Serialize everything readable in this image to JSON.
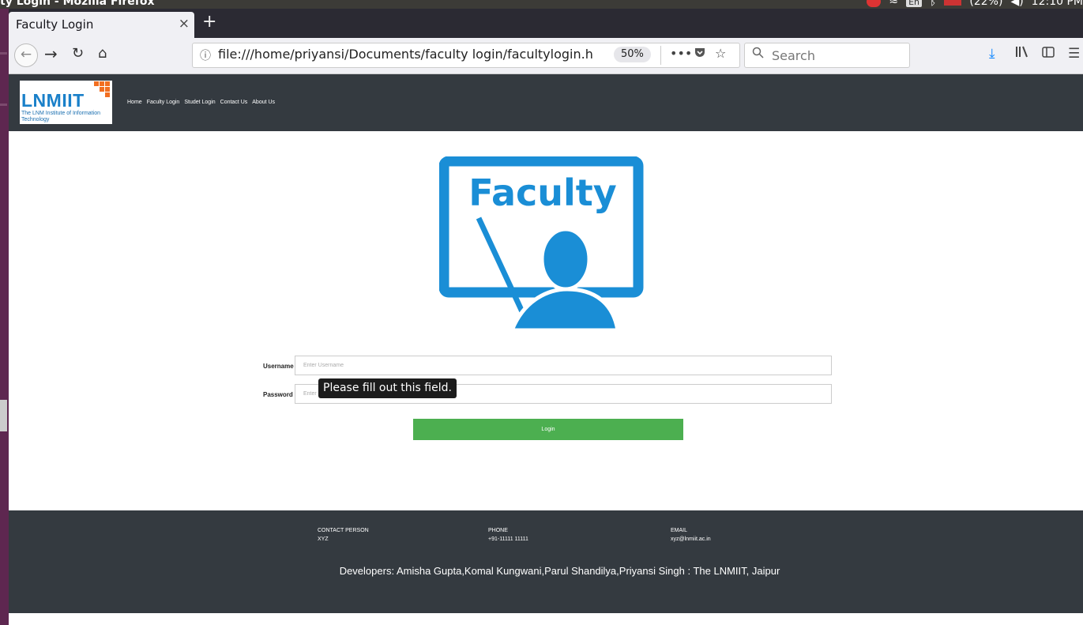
{
  "os": {
    "window_title": "ty Login - Mozilla Firefox",
    "tray": {
      "keyboard": "En",
      "battery": "(22%)",
      "clock": "12:10 PM"
    }
  },
  "browser": {
    "tab_title": "Faculty Login",
    "tab_close": "×",
    "new_tab": "+",
    "url": "file:///home/priyansi/Documents/faculty login/facultylogin.html",
    "zoom": "50%",
    "search_placeholder": "Search",
    "icons": [
      "back-icon",
      "forward-icon",
      "reload-icon",
      "home-icon",
      "info-icon",
      "more-icon",
      "pocket-icon",
      "bookmark-star-icon",
      "search-icon",
      "download-icon",
      "library-icon",
      "sidebar-icon",
      "menu-icon"
    ]
  },
  "site": {
    "logo": {
      "name": "LNMIIT",
      "subtitle": "The LNM Institute of Information Technology"
    },
    "nav": [
      "Home",
      "Faculty Login",
      "Studet Login",
      "Contact Us",
      "About Us"
    ],
    "hero_image_text": "Faculty",
    "form": {
      "username_label": "Username",
      "username_placeholder": "Enter Username",
      "password_label": "Password",
      "password_placeholder": "Enter Password",
      "tooltip": "Please fill out this field.",
      "login_button": "Login"
    },
    "footer": {
      "contact_title": "CONTACT PERSON",
      "contact_value": "XYZ",
      "phone_title": "PHONE",
      "phone_value": "+91-11111 11111",
      "email_title": "EMAIL",
      "email_value": "xyz@lnmiit.ac.in",
      "developers": "Developers: Amisha Gupta,Komal Kungwani,Parul Shandilya,Priyansi Singh : The LNMIIT, Jaipur"
    }
  },
  "colors": {
    "header_bg": "#343a40",
    "accent_blue": "#1a8ed6",
    "login_green": "#4caf50",
    "logo_orange": "#f26f21"
  }
}
